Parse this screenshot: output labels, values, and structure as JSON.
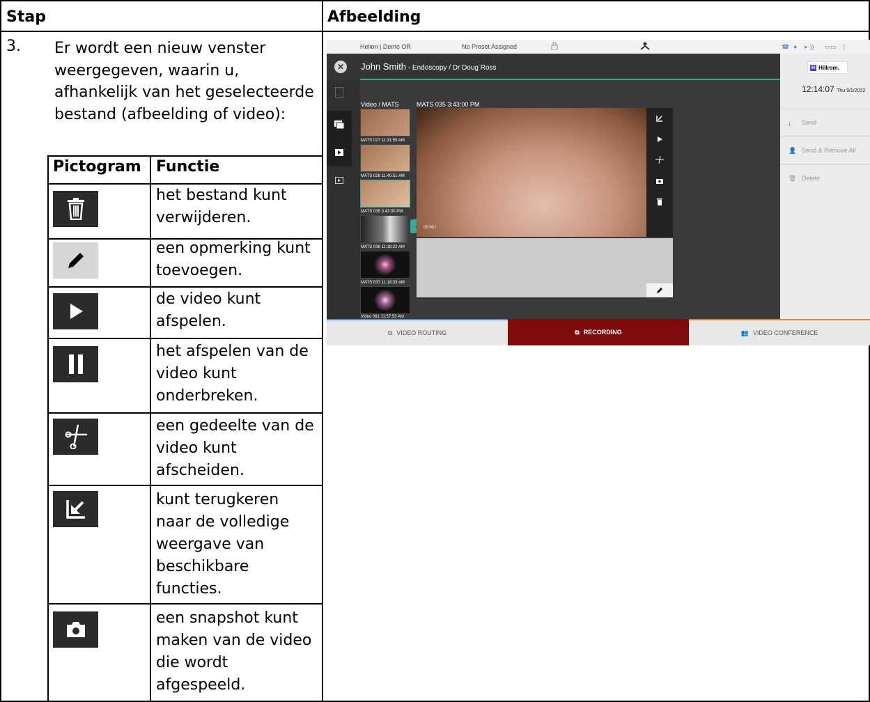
{
  "table": {
    "col_step": "Stap",
    "col_image": "Afbeelding",
    "step_number": "3.",
    "step_text": "Er wordt een nieuw venster weergegeven, waarin u, afhankelijk van het geselecteerde bestand (afbeelding of video):",
    "inner_col_icon": "Pictogram",
    "inner_col_function": "Functie",
    "rows": [
      {
        "icon": "trash-icon",
        "function": "het bestand kunt verwijderen."
      },
      {
        "icon": "pencil-icon",
        "function": "een opmerking kunt toevoegen."
      },
      {
        "icon": "play-icon",
        "function": "de video kunt afspelen."
      },
      {
        "icon": "pause-icon",
        "function": "het afspelen van de video kunt onderbreken."
      },
      {
        "icon": "scissors-icon",
        "function": "een gedeelte van de video kunt afscheiden."
      },
      {
        "icon": "collapse-arrow-icon",
        "function": "kunt terugkeren naar de volledige weergave van beschikbare functies."
      },
      {
        "icon": "camera-icon",
        "function": "een snapshot kunt maken van de video die wordt afgespeeld."
      }
    ]
  },
  "screenshot": {
    "topbar": {
      "room": "Helion | Demo OR",
      "preset": "No Preset Assigned"
    },
    "patient_name": "John Smith",
    "procedure": " - Endoscopy / Dr Doug Ross",
    "logo": "Hillrom.",
    "clock": {
      "time": "12:14:07",
      "date": "Thu 9/1/2022"
    },
    "video_col_label": "Video / MATS",
    "current_label": "MATS 035 3:43:00 PM",
    "thumbnails": [
      "MATS 027 11:31:55 AM",
      "MATS 028 11:40:51 AM",
      "MATS 035 3:43:00 PM",
      "MATS 036 11:18:22 AM",
      "MATS 037 11:18:33 AM",
      "Video 061 11:57:53 AM"
    ],
    "time_display": "00:00 /",
    "right_actions": [
      "Send",
      "Send & Remove All",
      "Delete"
    ],
    "tabs": [
      "VIDEO ROUTING",
      "RECORDING",
      "VIDEO CONFERENCE"
    ],
    "colors": {
      "tab_active": "#7e0c0c",
      "teal": "#3aa79a",
      "tab_inactive": "#e8e8e8"
    }
  }
}
